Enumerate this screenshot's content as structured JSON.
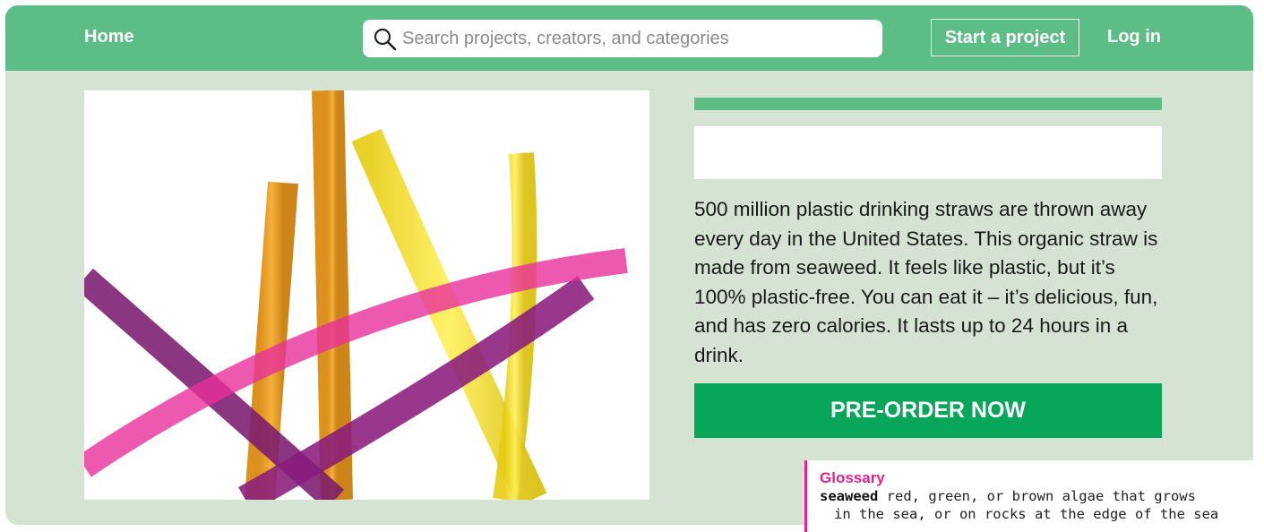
{
  "navbar": {
    "home_label": "Home",
    "search_placeholder": "Search projects, creators, and categories",
    "start_project_label": "Start a project",
    "login_label": "Log in"
  },
  "product": {
    "description": "500 million plastic drinking straws are thrown away every day in the United States. This organic straw is made from seaweed. It feels like plastic, but it’s 100% plastic-free. You can eat it – it’s delicious, fun, and has zero calories. It lasts up to 24 hours in a drink.",
    "preorder_label": "PRE-ORDER NOW"
  },
  "glossary": {
    "title": "Glossary",
    "term": "seaweed",
    "definition_line1": "red, green, or brown algae that grows",
    "definition_line2": "in the sea, or on rocks at the edge of the sea"
  },
  "colors": {
    "nav_green": "#5cbd87",
    "button_green": "#08a65a",
    "background": "#d4e3d2",
    "glossary_accent": "#e0248a"
  },
  "icons": [
    "search-icon"
  ]
}
